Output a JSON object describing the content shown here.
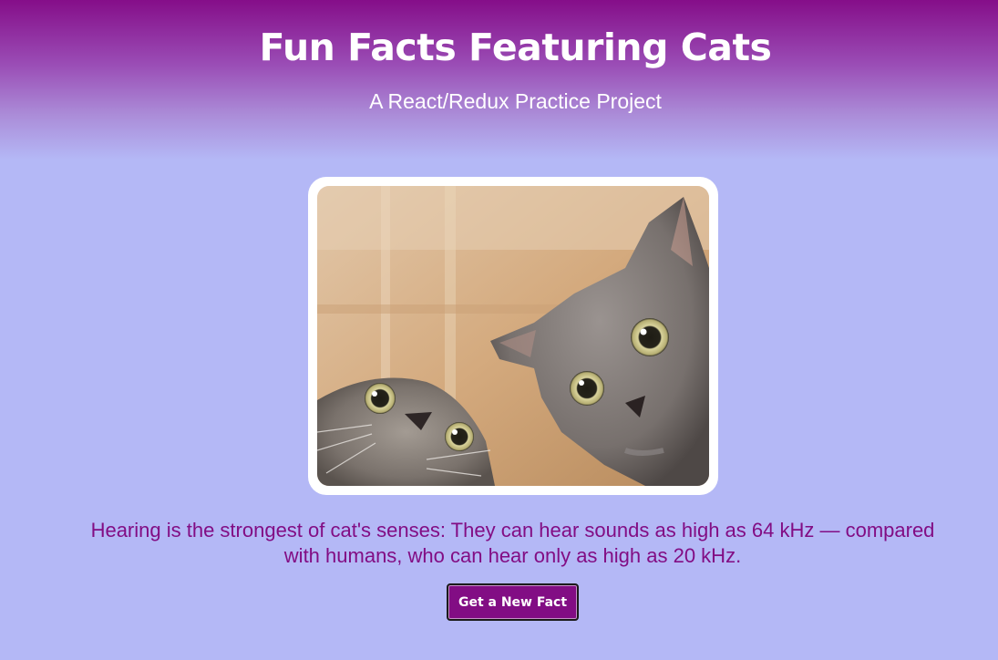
{
  "header": {
    "title": "Fun Facts Featuring Cats",
    "subtitle": "A React/Redux Practice Project"
  },
  "main": {
    "image_subject": "two gray cats looking up",
    "fact_text": "Hearing is the strongest of cat's senses: They can hear sounds as high as 64 kHz — compared with humans, who can hear only as high as 20 kHz.",
    "button_label": "Get a New Fact"
  },
  "colors": {
    "header_top": "#850e89",
    "background": "#b4b8f6",
    "fact_text": "#820d84",
    "button_bg": "#820d84"
  }
}
